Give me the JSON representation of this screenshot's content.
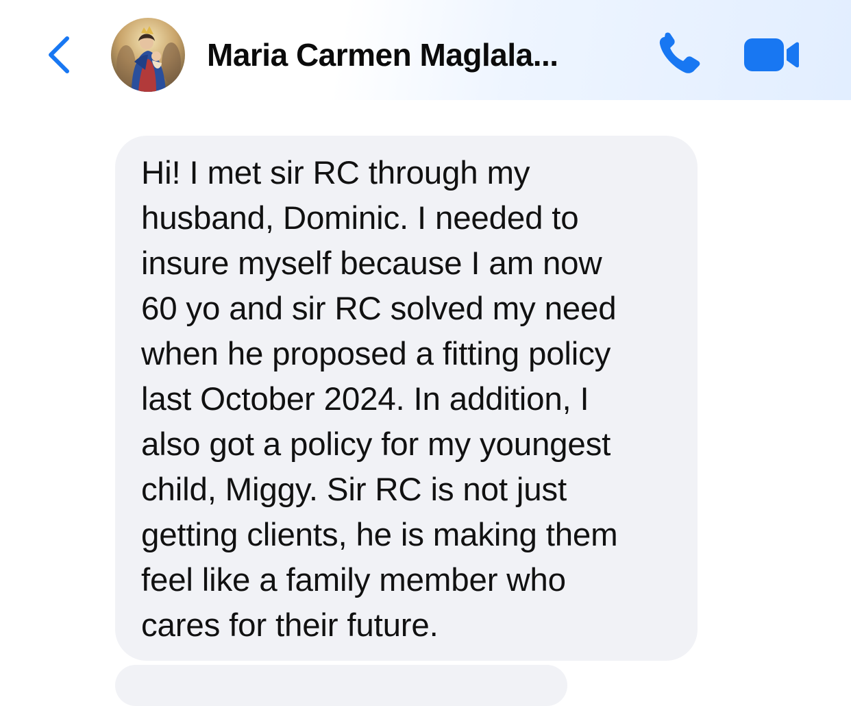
{
  "header": {
    "contact_name": "Maria Carmen Maglala...",
    "icons": {
      "back": "chevron-left-icon",
      "avatar": "avatar-image",
      "call": "phone-icon",
      "video": "video-camera-icon"
    },
    "accent_color": "#1877f2"
  },
  "messages": [
    {
      "sender": "contact",
      "text": "Hi! I met sir RC through my\nhusband, Dominic.  I needed to\ninsure myself because I am now\n60 yo and sir RC solved my need\nwhen he proposed a fitting policy\nlast October 2024.  In addition, I\nalso got a policy for my youngest\nchild, Miggy.  Sir RC is not just\ngetting clients, he is making them\nfeel like a family member who\ncares for their future."
    }
  ],
  "colors": {
    "incoming_bubble": "#f1f2f6",
    "text": "#111111"
  }
}
